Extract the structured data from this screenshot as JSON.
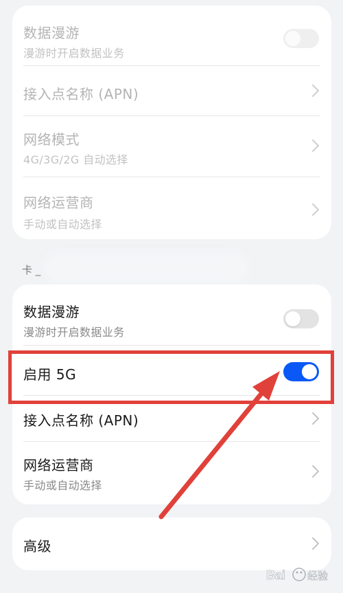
{
  "sim1": {
    "items": [
      {
        "title": "数据漫游",
        "subtitle": "漫游时开启数据业务",
        "control": "toggle",
        "state": "off",
        "enabled": false
      },
      {
        "title": "接入点名称 (APN)",
        "control": "chevron",
        "enabled": false
      },
      {
        "title": "网络模式",
        "subtitle": "4G/3G/2G 自动选择",
        "control": "chevron",
        "enabled": false
      },
      {
        "title": "网络运营商",
        "subtitle": "手动或自动选择",
        "control": "chevron",
        "enabled": false
      }
    ]
  },
  "sim2": {
    "section_label": "卡 _",
    "items": [
      {
        "title": "数据漫游",
        "subtitle": "漫游时开启数据业务",
        "control": "toggle",
        "state": "off",
        "enabled": true
      },
      {
        "title": "启用 5G",
        "control": "toggle",
        "state": "on",
        "enabled": true
      },
      {
        "title": "接入点名称 (APN)",
        "control": "chevron",
        "enabled": true
      },
      {
        "title": "网络运营商",
        "subtitle": "手动或自动选择",
        "control": "chevron",
        "enabled": true
      }
    ]
  },
  "advanced": {
    "title": "高级",
    "control": "chevron"
  },
  "annotation": {
    "highlight_color": "#e0413a"
  },
  "colors": {
    "accent": "#0a59f7",
    "background": "#f1f3f5",
    "card": "#ffffff"
  },
  "watermark": {
    "text": "Bai 经验"
  }
}
